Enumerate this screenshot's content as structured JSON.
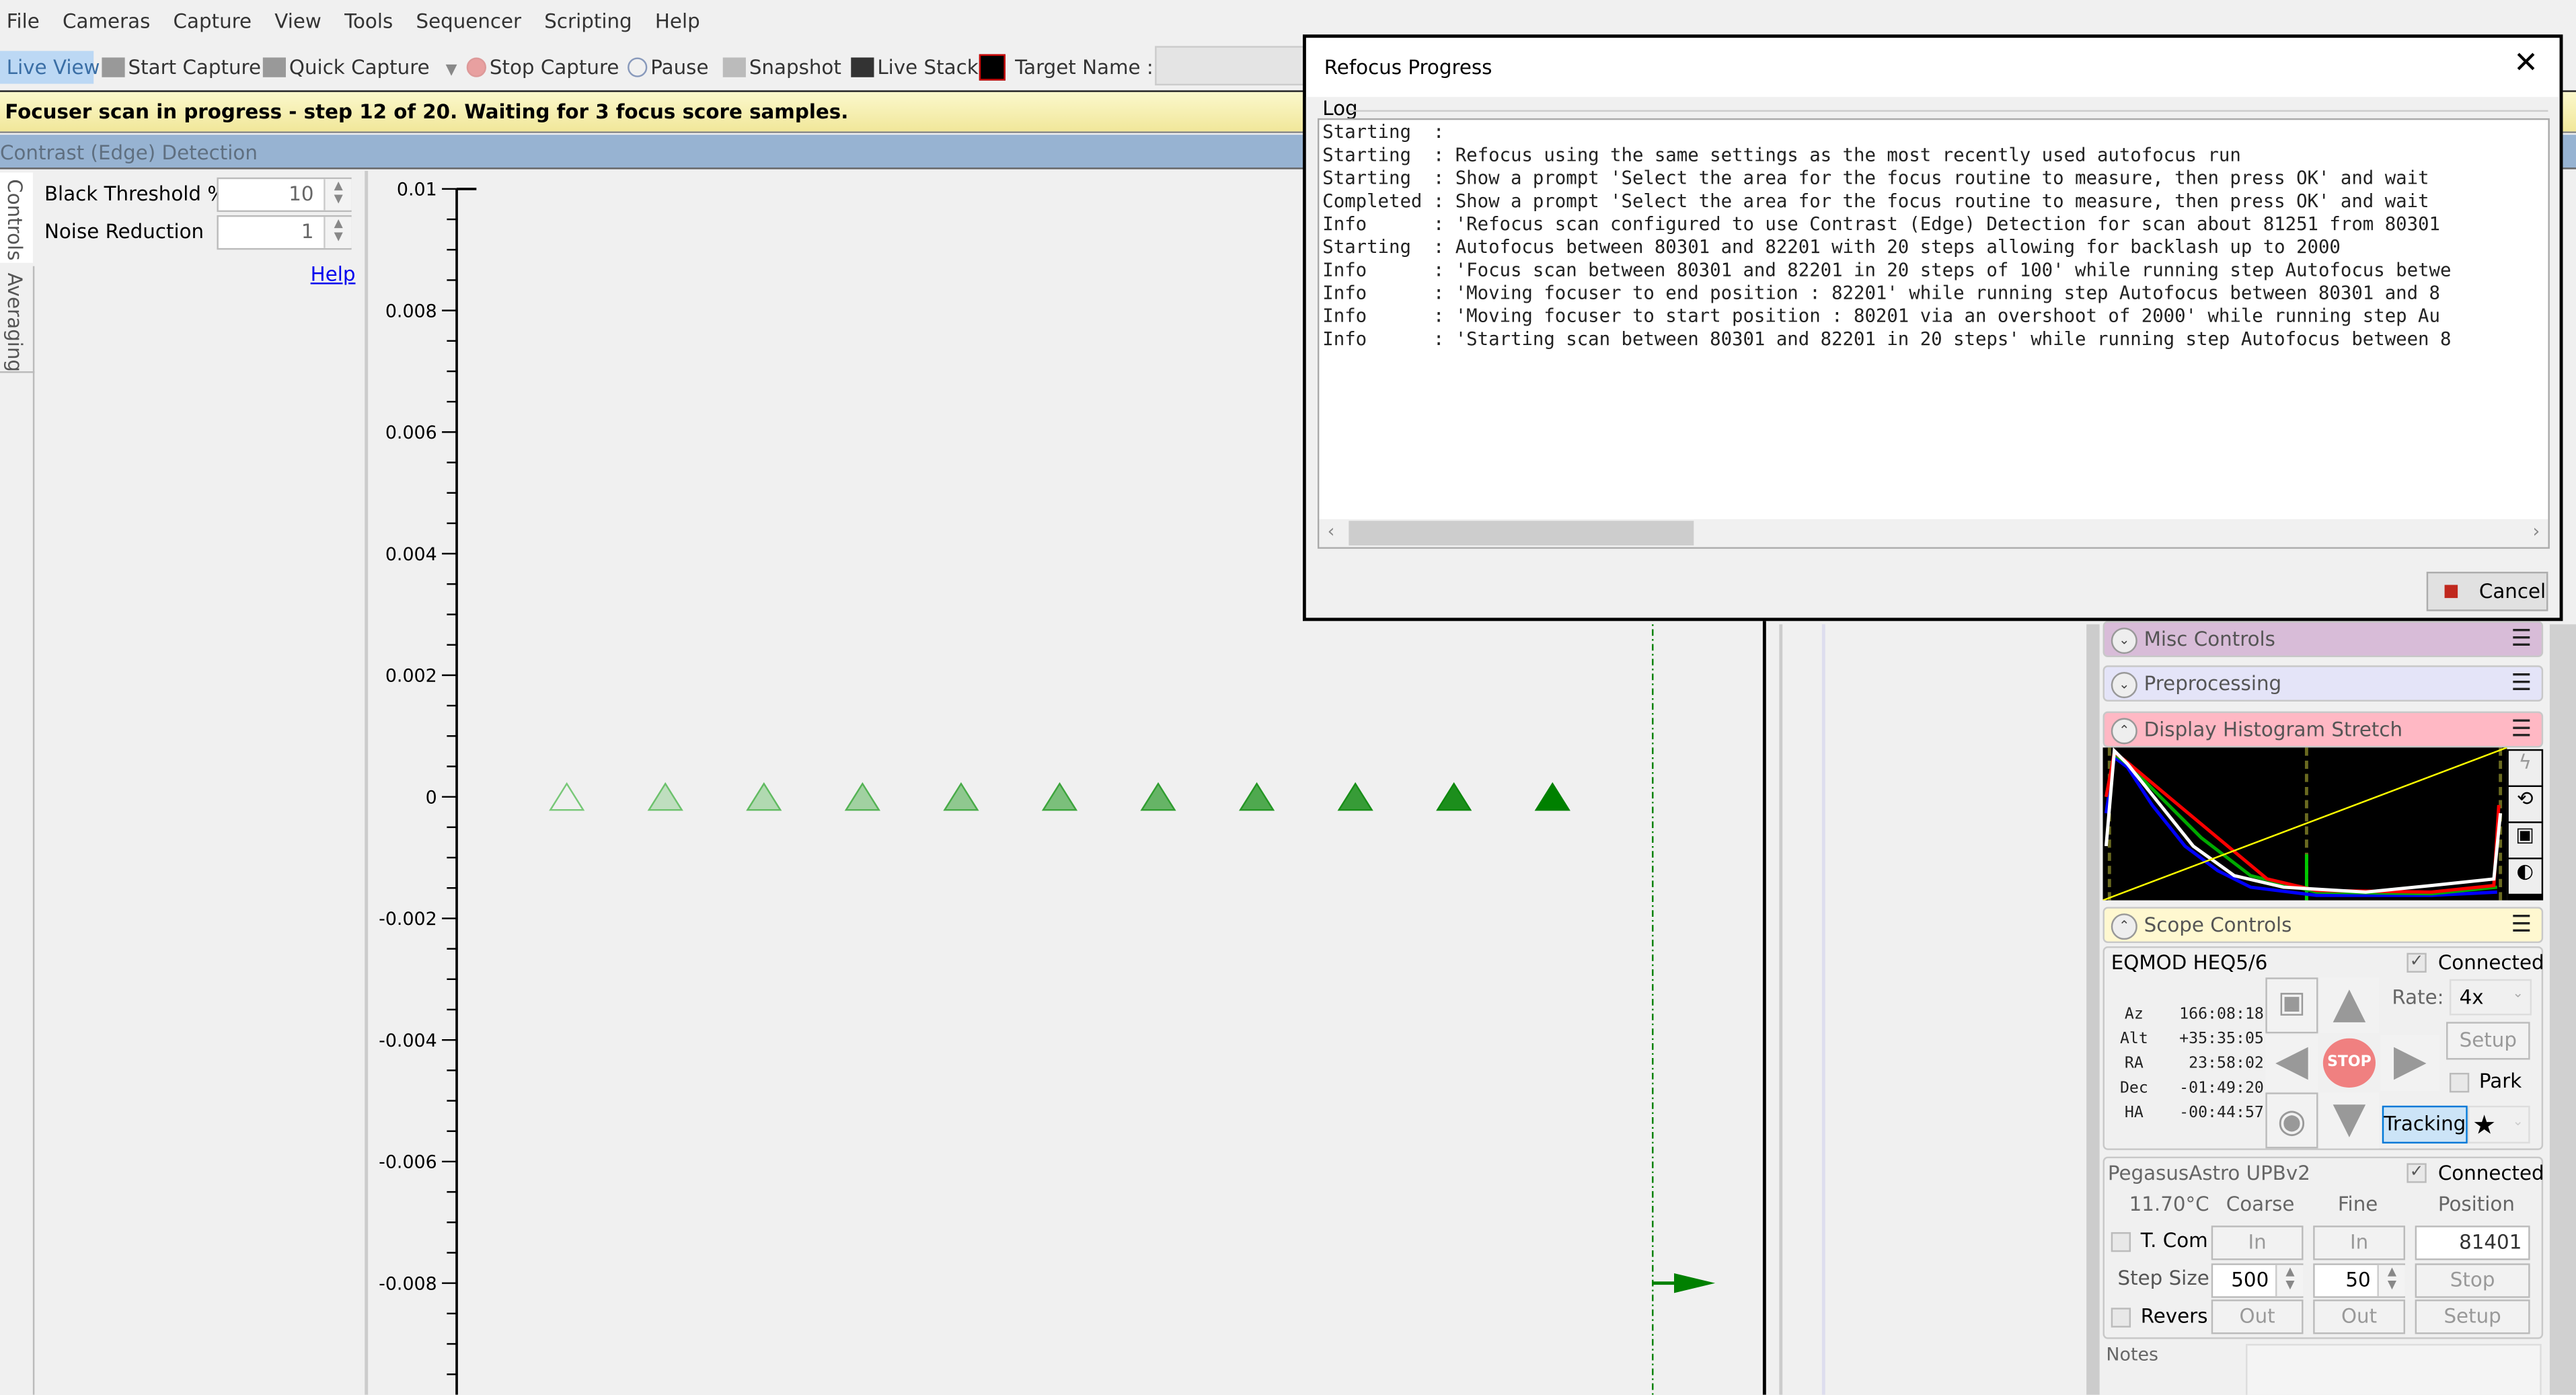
{
  "menu": [
    "File",
    "Cameras",
    "Capture",
    "View",
    "Tools",
    "Sequencer",
    "Scripting",
    "Help"
  ],
  "toolbar": {
    "live_view": "Live View",
    "start_capture": "Start Capture",
    "quick_capture": "Quick Capture",
    "stop_capture": "Stop Capture",
    "pause": "Pause",
    "snapshot": "Snapshot",
    "live_stack": "Live Stack",
    "target_name_label": "Target Name :",
    "target_name_value": ""
  },
  "status_banner": "Focuser scan in progress - step 12 of 20. Waiting for 3 focus score samples.",
  "section_title": "Contrast (Edge) Detection",
  "left_panel": {
    "tabs": [
      "Controls",
      "Averaging"
    ],
    "black_threshold_label": "Black Threshold %",
    "black_threshold_value": "10",
    "noise_reduction_label": "Noise Reduction",
    "noise_reduction_value": "1",
    "help_link": "Help"
  },
  "chart_data": {
    "type": "scatter",
    "marker": "triangle",
    "color": "#008000",
    "y_ticks": [
      "0.01",
      "0.008",
      "0.006",
      "0.004",
      "0.002",
      "0",
      "-0.002",
      "-0.004",
      "-0.006",
      "-0.008"
    ],
    "ylim": [
      -0.0098,
      0.01
    ],
    "points_y": [
      0,
      0,
      0,
      0,
      0,
      0,
      0,
      0,
      0,
      0,
      0
    ],
    "current_position_marker_y": -0.008
  },
  "dialog": {
    "title": "Refocus Progress",
    "log_label": "Log",
    "log": [
      {
        "level": "Starting ",
        "msg": ""
      },
      {
        "level": "Starting ",
        "msg": "Refocus using the same settings as the most recently used autofocus run"
      },
      {
        "level": "Starting ",
        "msg": "Show a prompt 'Select the area for the focus routine to measure, then press OK' and wait"
      },
      {
        "level": "Completed",
        "msg": "Show a prompt 'Select the area for the focus routine to measure, then press OK' and wait"
      },
      {
        "level": "Info     ",
        "msg": "'Refocus scan configured to use Contrast (Edge) Detection for scan about 81251 from 80301"
      },
      {
        "level": "Starting ",
        "msg": "Autofocus between 80301 and 82201 with 20 steps allowing for backlash up to 2000"
      },
      {
        "level": "Info     ",
        "msg": "'Focus scan between 80301 and 82201 in 20 steps of 100' while running step Autofocus betwe"
      },
      {
        "level": "Info     ",
        "msg": "'Moving focuser to end position : 82201' while running step Autofocus between 80301 and 8"
      },
      {
        "level": "Info     ",
        "msg": "'Moving focuser to start position : 80201 via an overshoot of 2000' while running step Au"
      },
      {
        "level": "Info     ",
        "msg": "'Starting scan between 80301 and 82201 in 20 steps' while running step Autofocus between 8"
      }
    ],
    "cancel": "Cancel"
  },
  "right_panel": {
    "misc_controls": "Misc Controls",
    "preprocessing": "Preprocessing",
    "histogram": "Display Histogram Stretch",
    "scope_controls": "Scope Controls",
    "colors": {
      "misc": "#d8bcd8",
      "pre": "#e4e4f8",
      "hist": "#ffb8c4",
      "scope": "#fff8d0"
    },
    "scope": {
      "name": "EQMOD HEQ5/6",
      "connected": "Connected",
      "coords": [
        {
          "k": "Az",
          "v": "166:08:18"
        },
        {
          "k": "Alt",
          "v": "+35:35:05"
        },
        {
          "k": "RA",
          "v": "23:58:02"
        },
        {
          "k": "Dec",
          "v": "-01:49:20"
        },
        {
          "k": "HA",
          "v": "-00:44:57"
        }
      ],
      "stop": "STOP",
      "rate_label": "Rate:",
      "rate_value": "4x",
      "setup": "Setup",
      "park": "Park",
      "tracking": "Tracking"
    },
    "focuser": {
      "name": "PegasusAstro UPBv2",
      "connected": "Connected",
      "temperature": "11.70°C",
      "coarse": "Coarse",
      "fine": "Fine",
      "position_label": "Position",
      "tcomp": "T. Com",
      "in": "In",
      "position": "81401",
      "step_size": "Step Size",
      "coarse_step": "500",
      "fine_step": "50",
      "stop": "Stop",
      "reverse": "Revers",
      "out": "Out",
      "setup": "Setup"
    },
    "notes": "Notes"
  }
}
